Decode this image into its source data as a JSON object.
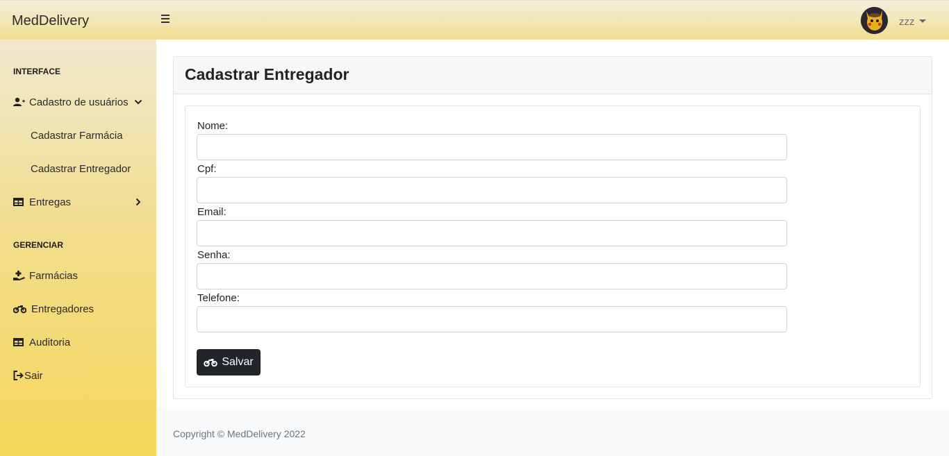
{
  "header": {
    "brand": "MedDelivery",
    "user_name": "zzz"
  },
  "sidebar": {
    "sections": [
      {
        "heading": "INTERFACE"
      },
      {
        "heading": "GERENCIAR"
      }
    ],
    "items": {
      "cadastro": "Cadastro de usuários",
      "cadastrar_farmacia": "Cadastrar Farmácia",
      "cadastrar_entregador": "Cadastrar Entregador",
      "entregas": "Entregas",
      "farmacias": "Farmácias",
      "entregadores": "Entregadores",
      "auditoria": "Auditoria",
      "sair": "Sair"
    }
  },
  "form": {
    "title": "Cadastrar Entregador",
    "fields": [
      {
        "label": "Nome:",
        "value": ""
      },
      {
        "label": "Cpf:",
        "value": ""
      },
      {
        "label": "Email:",
        "value": ""
      },
      {
        "label": "Senha:",
        "value": ""
      },
      {
        "label": "Telefone:",
        "value": ""
      }
    ],
    "submit_label": "Salvar"
  },
  "footer": {
    "copyright": "Copyright © MedDelivery 2022"
  },
  "colors": {
    "topbar_start": "#f3eedd",
    "topbar_end": "#f1df8f",
    "sidebar_bottom": "#f7d75a",
    "button_bg": "#212529"
  }
}
